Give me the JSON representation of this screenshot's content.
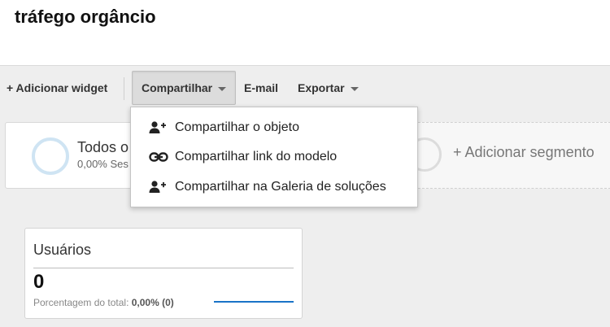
{
  "page": {
    "title": "tráfego orgâncio"
  },
  "toolbar": {
    "add_widget": "+ Adicionar widget",
    "share": "Compartilhar",
    "email": "E-mail",
    "export": "Exportar"
  },
  "segments": {
    "current": {
      "name": "Todos o",
      "subtitle": "0,00% Ses"
    },
    "add_label": "+ Adicionar segmento"
  },
  "share_menu": {
    "items": [
      {
        "label": "Compartilhar o objeto",
        "icon": "add-person-icon"
      },
      {
        "label": "Compartilhar link do modelo",
        "icon": "link-icon"
      },
      {
        "label": "Compartilhar na Galeria de soluções",
        "icon": "add-person-icon"
      }
    ]
  },
  "metric": {
    "title": "Usuários",
    "value": "0",
    "footer_label": "Porcentagem do total:",
    "footer_value": "0,00% (0)"
  },
  "colors": {
    "accent": "#1a73c7",
    "ring": "#cfe4f3"
  }
}
